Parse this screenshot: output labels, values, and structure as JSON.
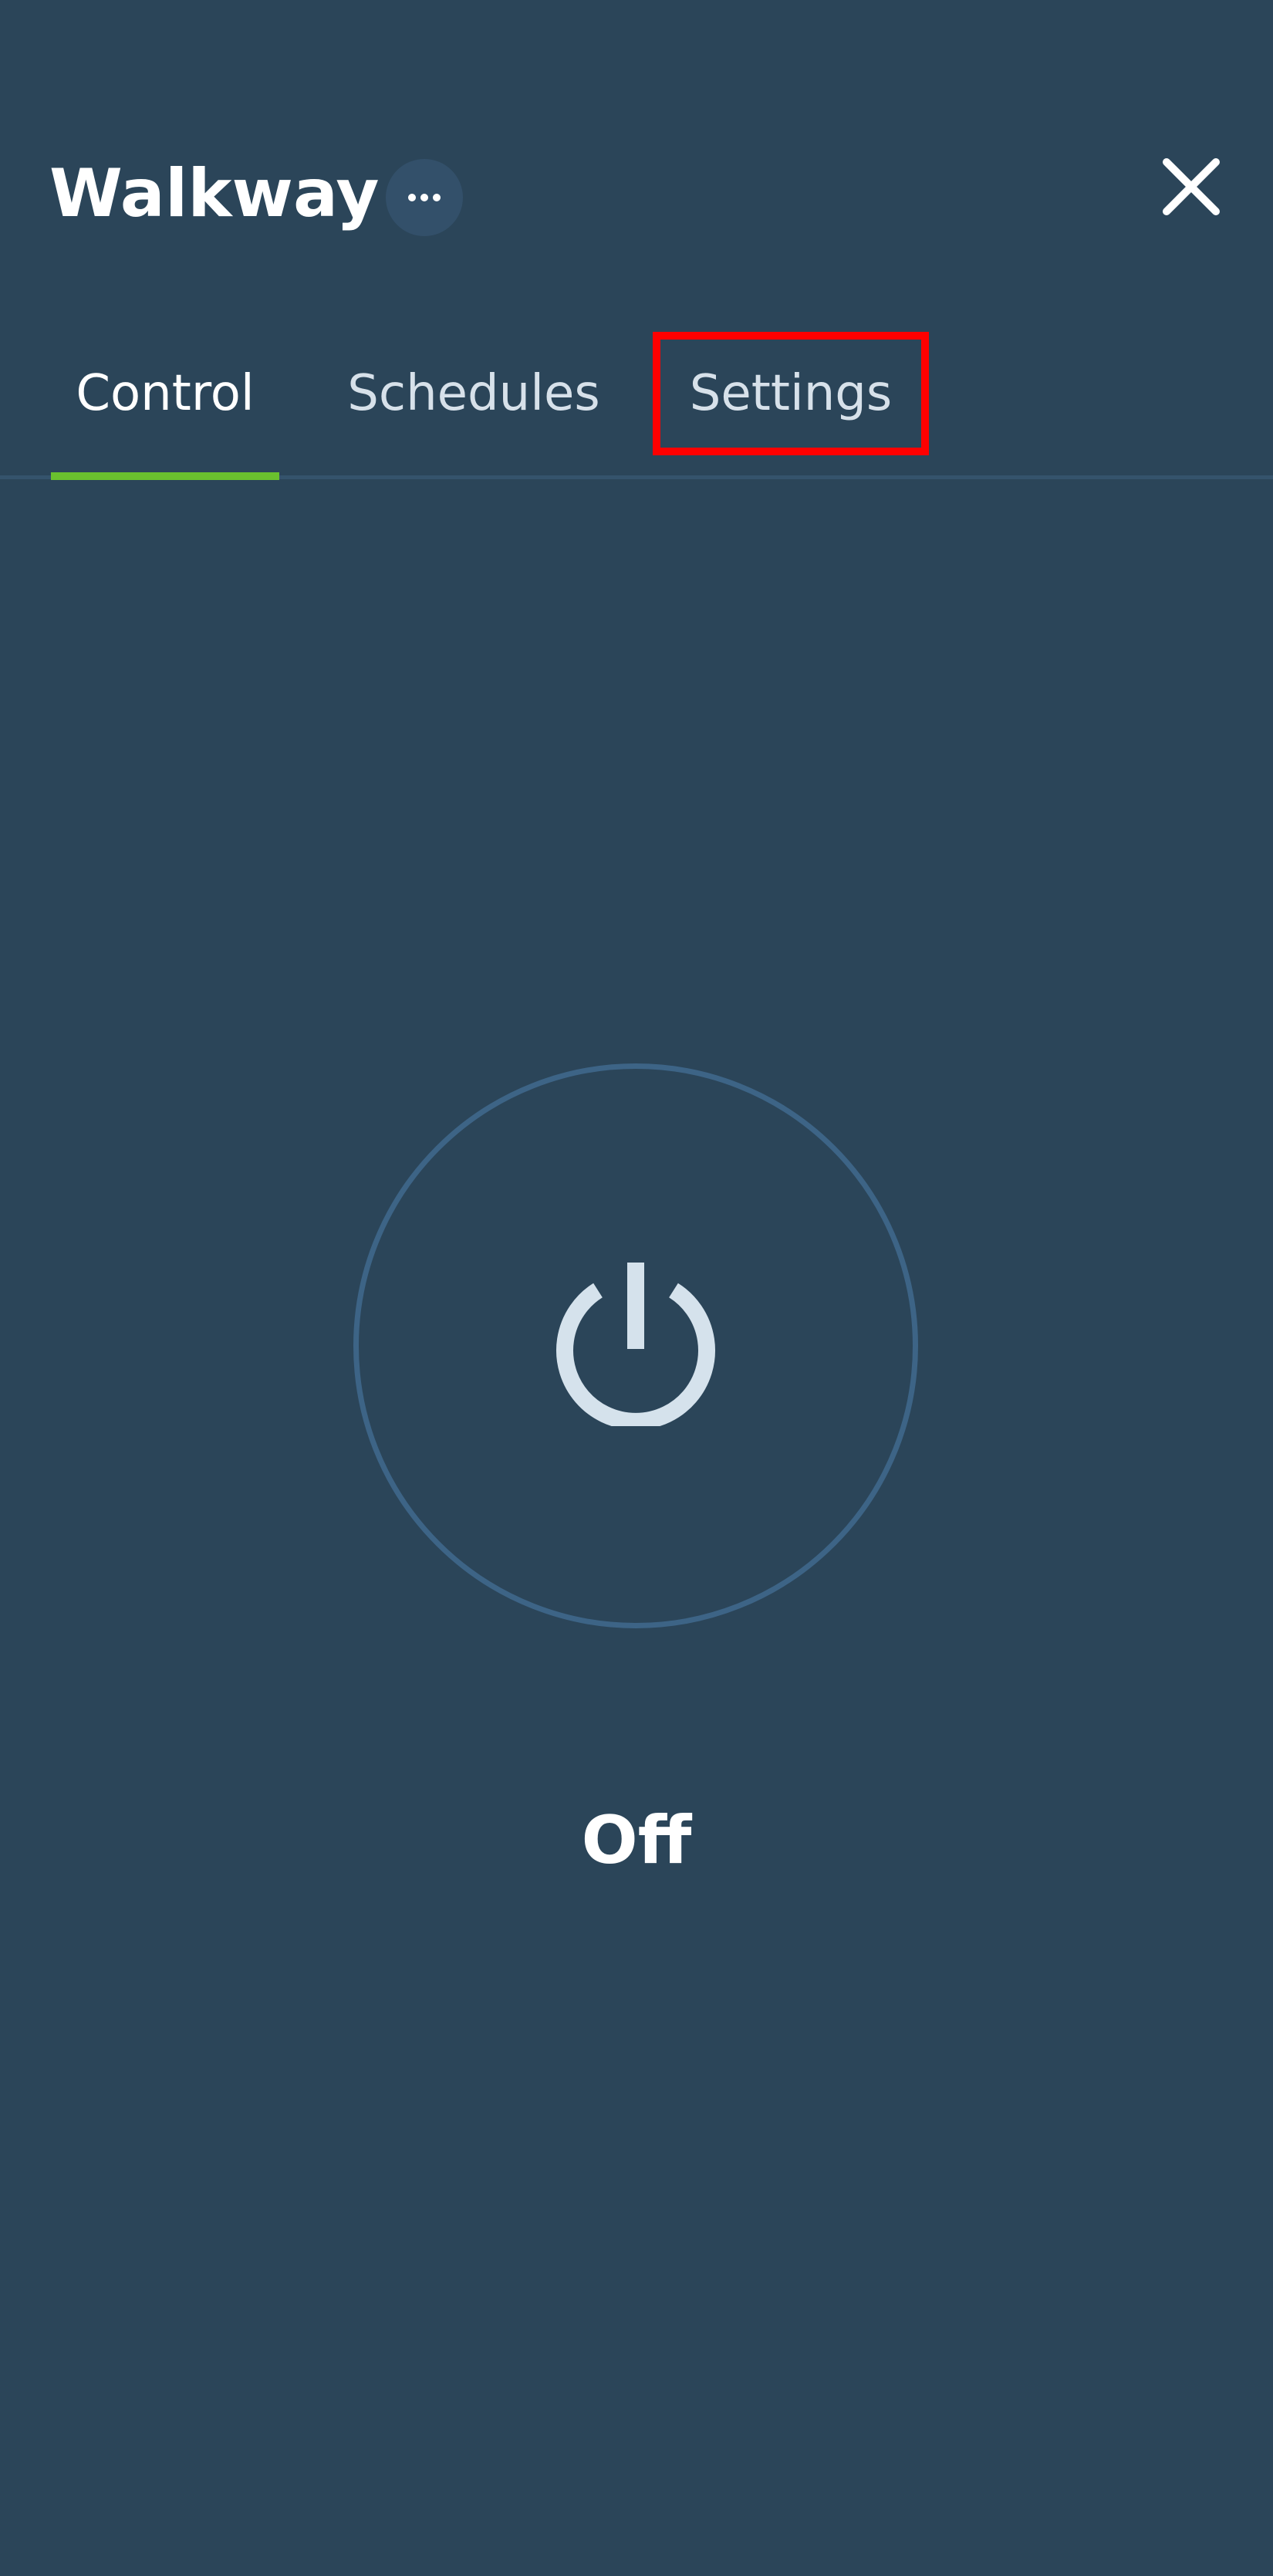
{
  "header": {
    "title": "Walkway",
    "more_icon": "ellipsis-icon",
    "close_icon": "close-icon"
  },
  "tabs": [
    {
      "label": "Control",
      "active": true
    },
    {
      "label": "Schedules",
      "active": false
    },
    {
      "label": "Settings",
      "active": false,
      "highlighted": true
    }
  ],
  "power": {
    "icon": "power-icon",
    "state": "Off"
  },
  "colors": {
    "background": "#2b4559",
    "accent": "#6ac02e",
    "ring": "#3d6486",
    "highlight": "#ff0000"
  }
}
